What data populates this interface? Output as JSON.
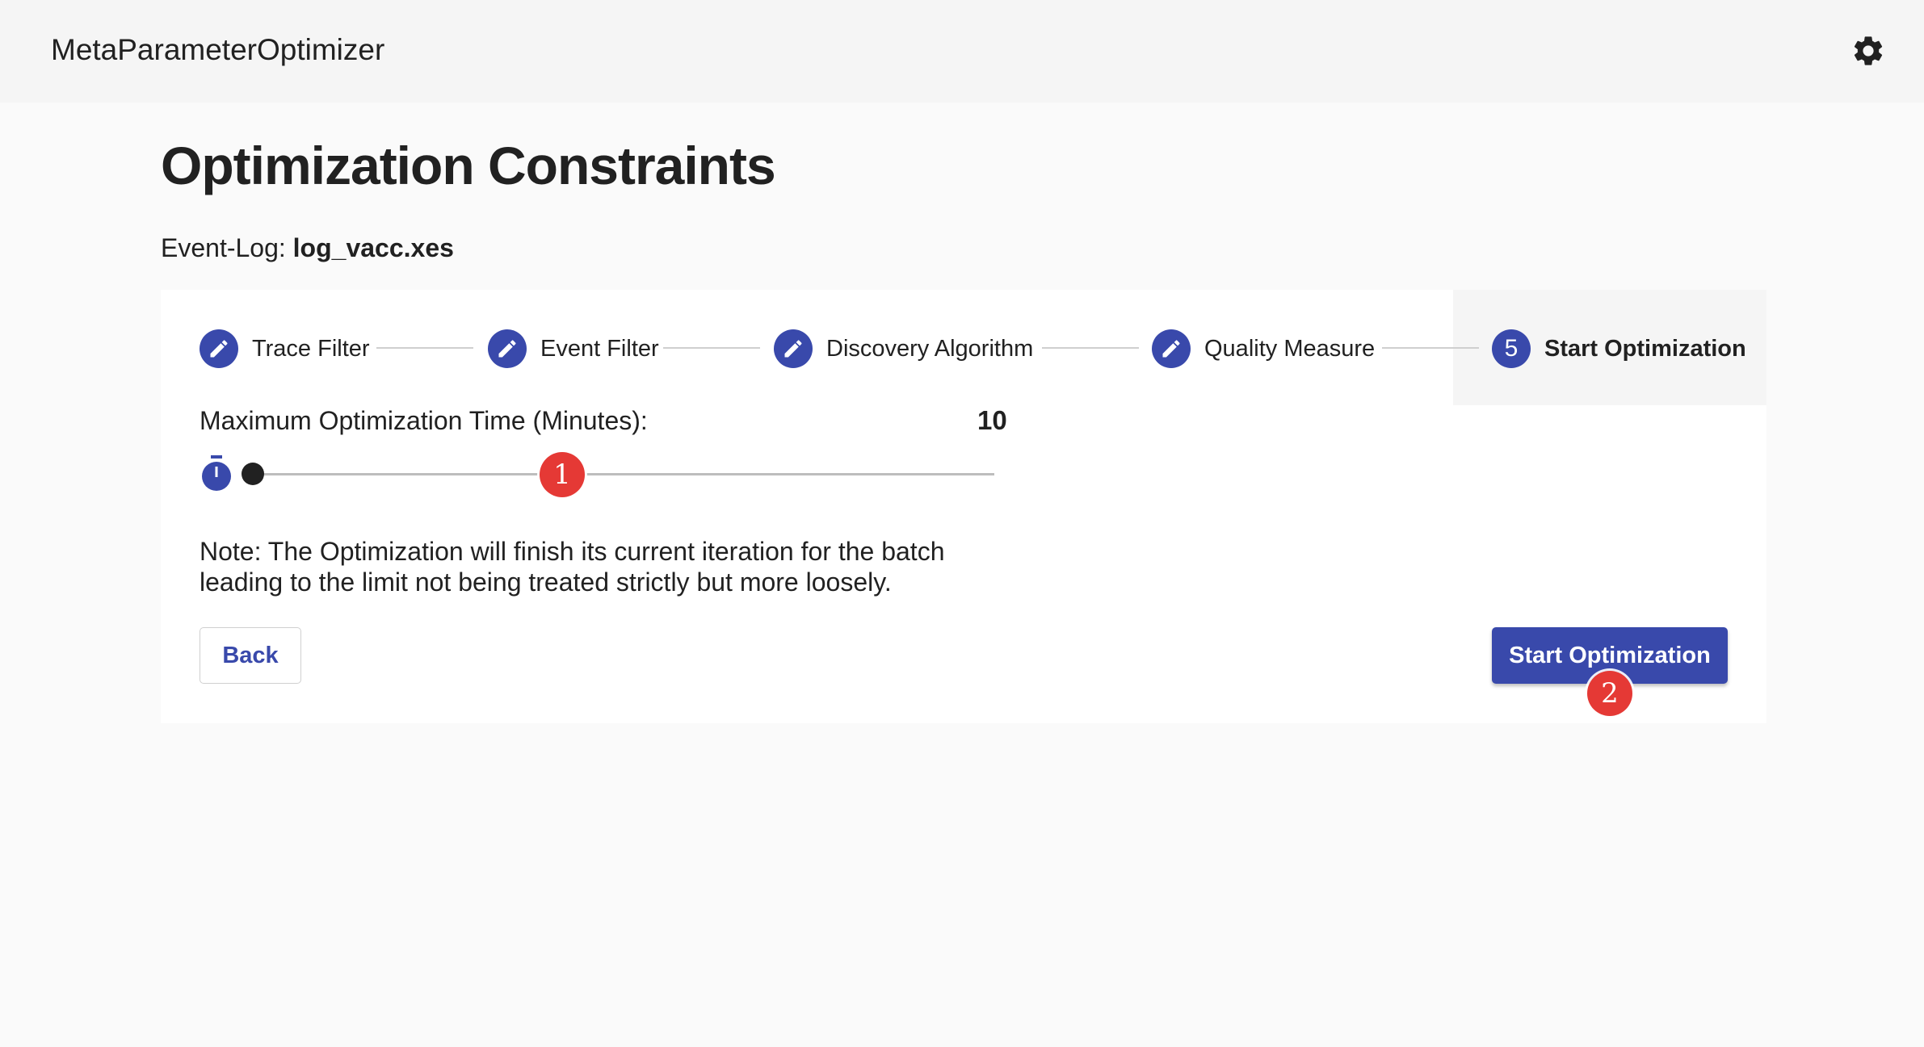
{
  "app": {
    "title": "MetaParameterOptimizer",
    "settings_icon": "gear-icon"
  },
  "page": {
    "title": "Optimization Constraints",
    "event_log_label": "Event-Log:",
    "event_log_file": "log_vacc.xes"
  },
  "stepper": {
    "steps": [
      {
        "label": "Trace Filter",
        "state": "completed",
        "icon": "pencil-icon"
      },
      {
        "label": "Event Filter",
        "state": "completed",
        "icon": "pencil-icon"
      },
      {
        "label": "Discovery Algorithm",
        "state": "completed",
        "icon": "pencil-icon"
      },
      {
        "label": "Quality Measure",
        "state": "completed",
        "icon": "pencil-icon"
      },
      {
        "label": "Start Optimization",
        "state": "active",
        "number": "5"
      }
    ]
  },
  "constraint": {
    "label": "Maximum Optimization Time (Minutes):",
    "value": "10",
    "icon": "timer-icon",
    "slider_fraction": 0.0
  },
  "note": "Note: The Optimization will finish its current iteration for the batch leading to the limit not being treated strictly but more loosely.",
  "buttons": {
    "back": "Back",
    "start": "Start Optimization"
  },
  "annotations": {
    "marker_1": "1",
    "marker_2": "2"
  },
  "colors": {
    "primary": "#3949ab",
    "marker": "#e53935",
    "appbar": "#f5f5f5",
    "background": "#fafafa"
  }
}
